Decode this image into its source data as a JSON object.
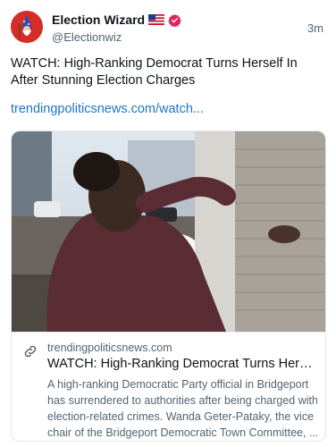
{
  "post": {
    "author_name": "Election Wizard",
    "author_handle": "@Electionwiz",
    "timestamp": "3m",
    "flag_icon": "us-flag-icon",
    "verified_icon": "verified-badge-icon",
    "text": "WATCH: High-Ranking Democrat Turns Herself In After Stunning Election Charges",
    "link_text": "trendingpoliticsnews.com/watch..."
  },
  "card": {
    "domain": "trendingpoliticsnews.com",
    "title": "WATCH: High-Ranking Democrat Turns Herself...",
    "description_lines": [
      "A high-ranking Democratic Party official in Bridgeport",
      "has surrendered to authorities after being charged with",
      "election-related crimes. Wanda Geter-Pataky, the vice",
      "chair of the Bridgeport Democratic Town Committee, ..."
    ],
    "link_icon": "link-icon"
  },
  "colors": {
    "link": "#1d74c9",
    "verified": "#e0245e",
    "avatar_bg": "#d62d27"
  }
}
